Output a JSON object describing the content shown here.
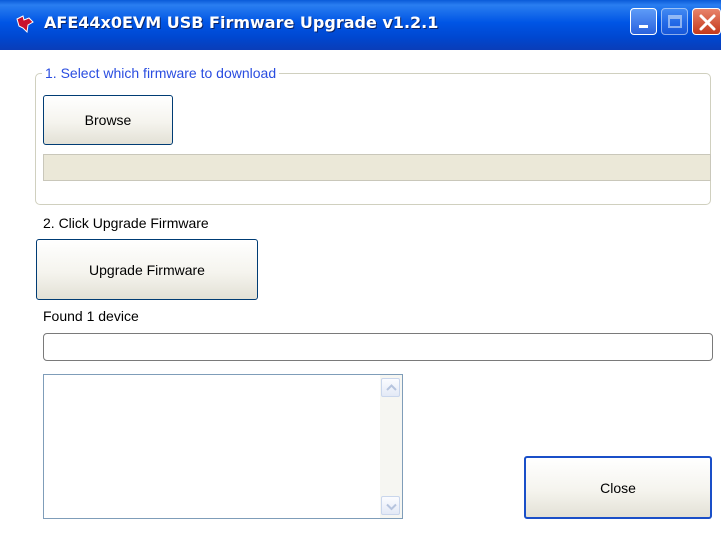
{
  "window": {
    "title": "AFE44x0EVM USB Firmware Upgrade v1.2.1",
    "title_bar_color": "#0055e5"
  },
  "icons": {
    "app": "ti-logo-icon",
    "minimize": "minimize-icon",
    "maximize": "maximize-icon",
    "close": "close-icon",
    "scroll_up": "chevron-up-icon",
    "scroll_down": "chevron-down-icon"
  },
  "step1": {
    "group_label": "1. Select which firmware to download",
    "browse_label": "Browse",
    "file_path_value": ""
  },
  "step2": {
    "label": "2. Click Upgrade Firmware",
    "upgrade_label": "Upgrade Firmware"
  },
  "status": {
    "device_text": "Found 1 device",
    "progress": 0,
    "log_text": ""
  },
  "footer": {
    "close_label": "Close"
  }
}
